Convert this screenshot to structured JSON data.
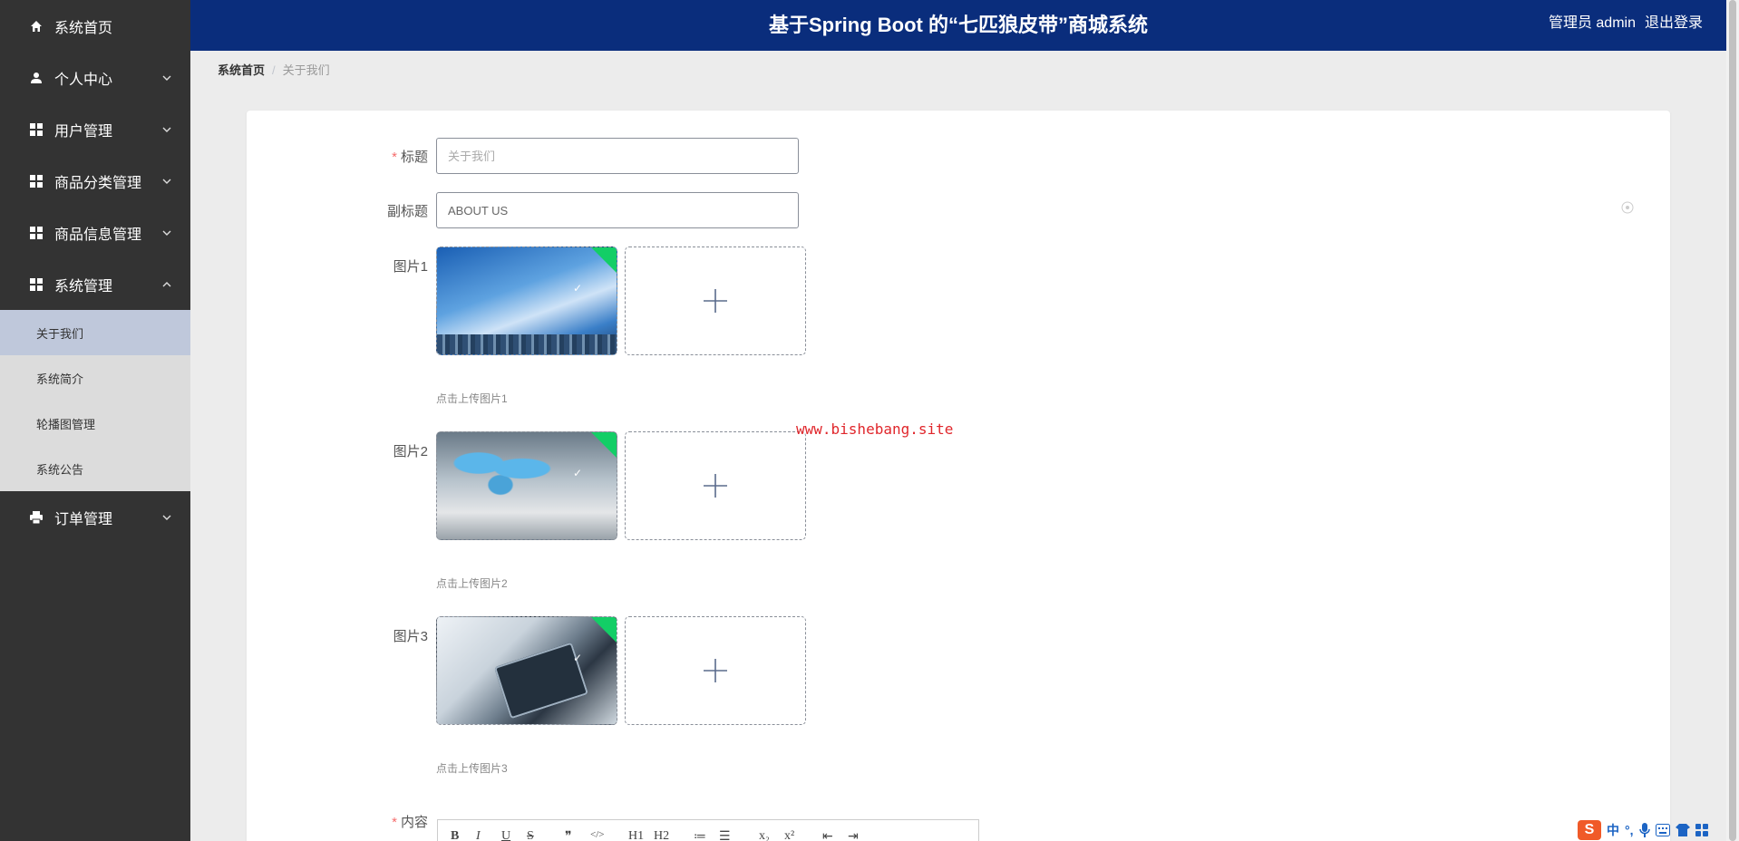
{
  "header": {
    "title": "基于Spring Boot 的“七匹狼皮带”商城系统",
    "role": "管理员 admin",
    "logout": "退出登录"
  },
  "sidebar": {
    "items": [
      {
        "label": "系统首页",
        "icon": "home-icon"
      },
      {
        "label": "个人中心",
        "icon": "user-icon",
        "expandable": true
      },
      {
        "label": "用户管理",
        "icon": "grid-icon",
        "expandable": true
      },
      {
        "label": "商品分类管理",
        "icon": "grid-icon",
        "expandable": true
      },
      {
        "label": "商品信息管理",
        "icon": "grid-icon",
        "expandable": true
      },
      {
        "label": "系统管理",
        "icon": "grid-icon",
        "expandable": true,
        "expanded": true
      },
      {
        "label": "订单管理",
        "icon": "print-icon",
        "expandable": true
      }
    ],
    "submenu": [
      "关于我们",
      "系统简介",
      "轮播图管理",
      "系统公告"
    ],
    "active_sub": "关于我们"
  },
  "breadcrumb": {
    "home": "系统首页",
    "current": "关于我们"
  },
  "form": {
    "title_label": "标题",
    "title_placeholder": "关于我们",
    "subtitle_label": "副标题",
    "subtitle_value": "ABOUT US",
    "images": [
      {
        "label": "图片1",
        "tip": "点击上传图片1"
      },
      {
        "label": "图片2",
        "tip": "点击上传图片2"
      },
      {
        "label": "图片3",
        "tip": "点击上传图片3"
      }
    ],
    "content_label": "内容"
  },
  "watermark": "www.bishebang.site",
  "editor_toolbar": [
    "B",
    "I",
    "U",
    "S",
    "❞",
    "</>",
    "H1",
    "H2",
    "≔",
    "☰",
    "x₂",
    "x²",
    "⇤",
    "⇥"
  ],
  "ime": {
    "logo": "S",
    "mode": "中",
    "punct": "°,"
  },
  "colors": {
    "header_bg": "#0a2d7c",
    "sidebar_bg": "#333333",
    "submenu_bg": "#dcdcdc",
    "active_sub_bg": "#bfc8db",
    "required": "#f56c6c",
    "watermark": "#e0262b"
  }
}
